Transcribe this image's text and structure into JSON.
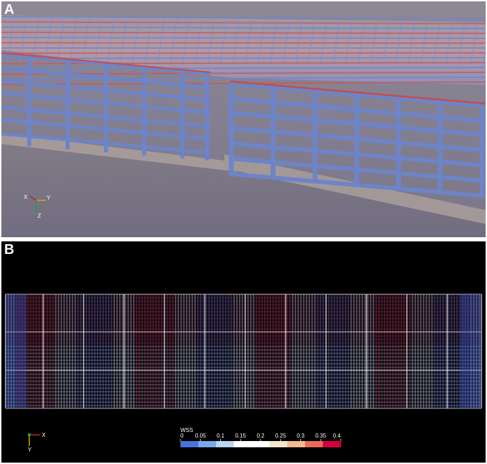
{
  "panel_a": {
    "letter": "A",
    "axes": {
      "x": "X",
      "y": "Y",
      "z": "Z"
    }
  },
  "panel_b": {
    "letter": "B",
    "axes": {
      "x": "X",
      "y": "Y"
    },
    "colorbar": {
      "title": "WSS",
      "ticks": [
        "0",
        "0.05",
        "0.1",
        "0.15",
        "0.2",
        "0.25",
        "0.3",
        "0.35",
        "0.4"
      ],
      "colors": [
        "#4a6fe0",
        "#7aa8ee",
        "#b9d6f2",
        "#ffffff",
        "#ffffff",
        "#f2e7cc",
        "#f3b993",
        "#e9695a",
        "#d6003a"
      ]
    }
  },
  "colors": {
    "tube": "#6d84c8",
    "tube_highlight": "#c94a4a",
    "floor": "#8f8585",
    "background_a": "#7f7a8c",
    "background_b": "#000000"
  }
}
